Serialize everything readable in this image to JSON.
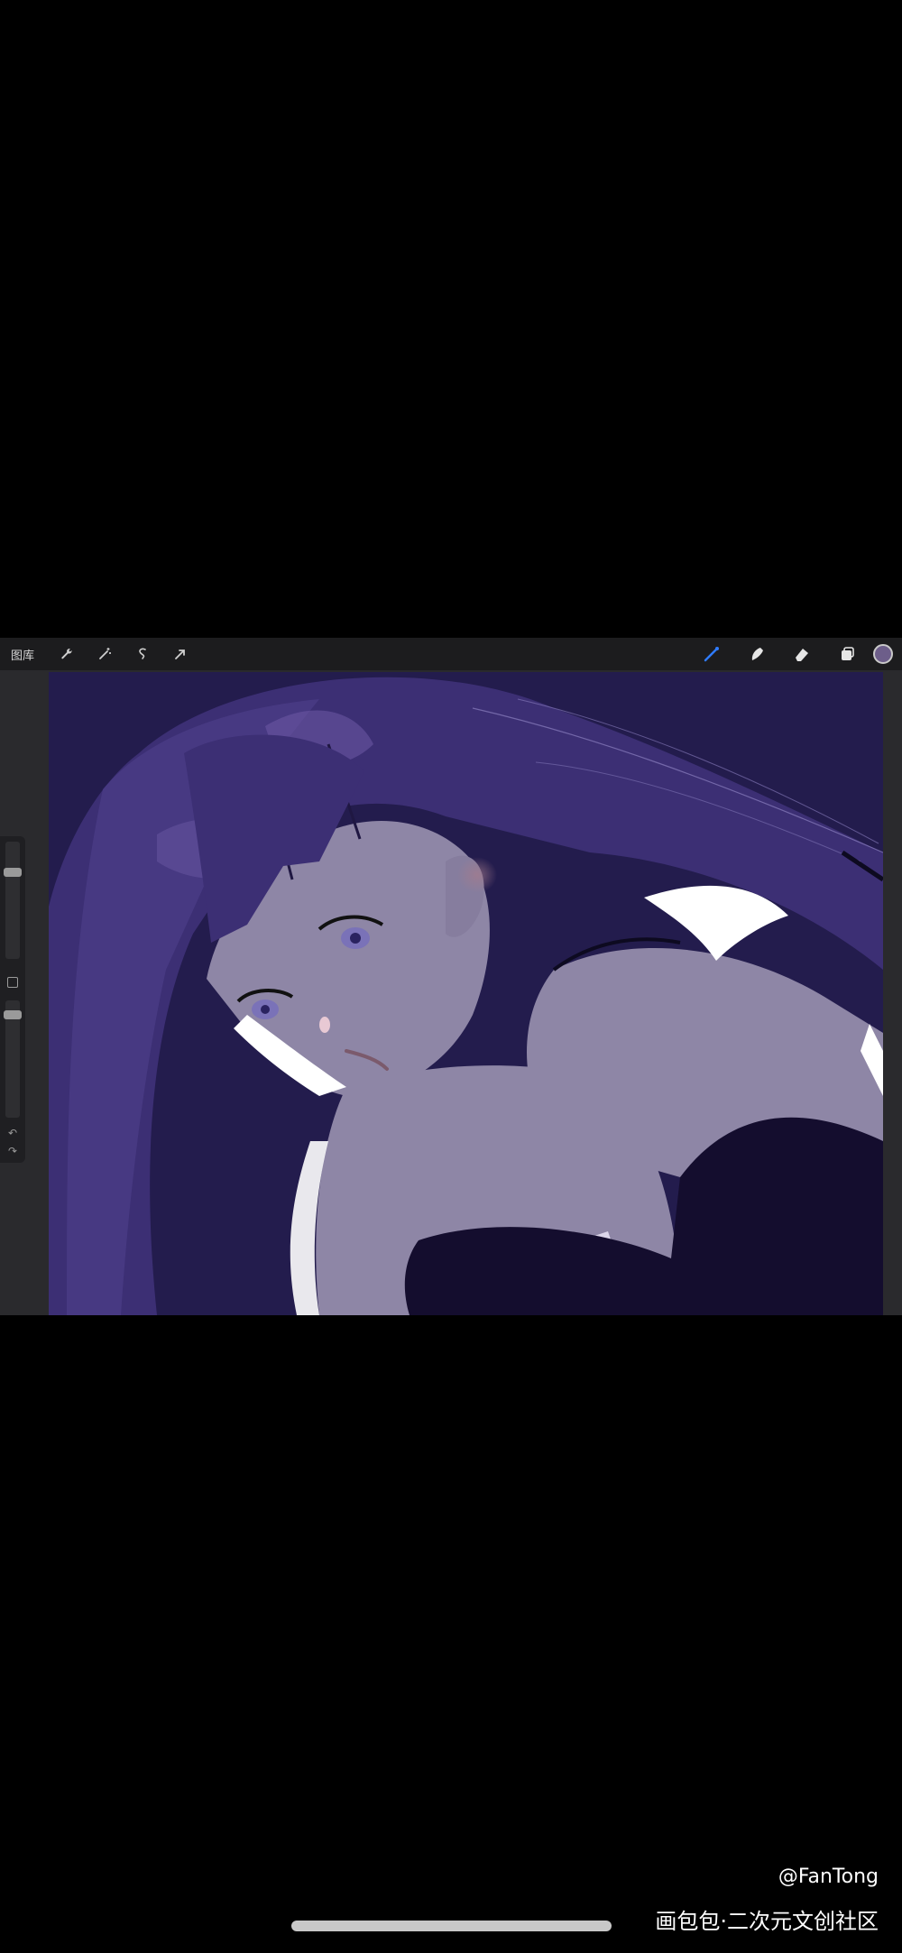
{
  "toolbar": {
    "gallery_label": "图库",
    "left_tools": [
      "wrench-icon",
      "magic-wand-icon",
      "selection-icon",
      "transform-icon"
    ],
    "right_tools": [
      "brush-icon",
      "smudge-icon",
      "eraser-icon",
      "layers-icon"
    ],
    "active_tool": "brush-icon",
    "current_color": "#6d5e8a"
  },
  "colors": {
    "canvas_background": "#231c4d",
    "hair": "#3c2f74",
    "skin": "#8e86a6",
    "dress": "#140d2e",
    "highlight": "#ffffff",
    "accent_blue": "#2f7bff"
  },
  "watermark": {
    "author": "@FanTong",
    "site": "画包包·二次元文创社区"
  }
}
